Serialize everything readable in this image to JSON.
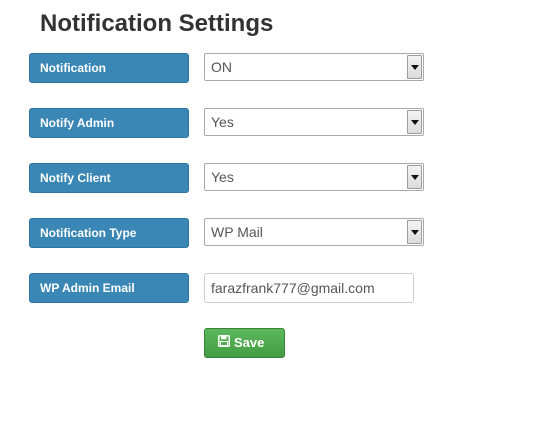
{
  "page": {
    "title": "Notification Settings"
  },
  "form": {
    "notification": {
      "label": "Notification",
      "value": "ON"
    },
    "notify_admin": {
      "label": "Notify Admin",
      "value": "Yes"
    },
    "notify_client": {
      "label": "Notify Client",
      "value": "Yes"
    },
    "notification_type": {
      "label": "Notification Type",
      "value": "WP Mail"
    },
    "admin_email": {
      "label": "WP Admin Email",
      "value": "farazfrank777@gmail.com"
    }
  },
  "actions": {
    "save_label": "Save",
    "save_icon": "floppy-disk-icon"
  },
  "colors": {
    "label_bg": "#3a87b5",
    "save_bg": "#5cb85c",
    "title_text": "#333333"
  }
}
